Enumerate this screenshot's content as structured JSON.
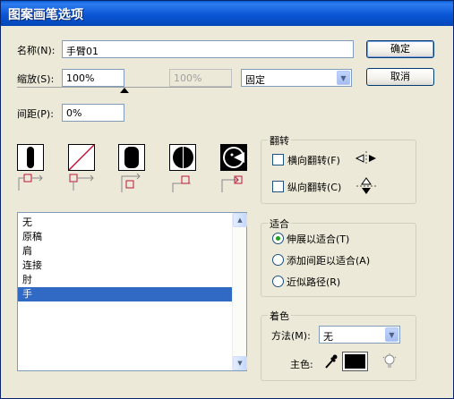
{
  "window": {
    "title": "图案画笔选项"
  },
  "name": {
    "label": "名称(N):",
    "value": "手臂01"
  },
  "scale": {
    "label": "缩放(S):",
    "value": "100%",
    "max_value": "100%",
    "mode": "固定"
  },
  "spacing": {
    "label": "间距(P):",
    "value": "0%"
  },
  "buttons": {
    "ok": "确定",
    "cancel": "取消"
  },
  "flip": {
    "title": "翻转",
    "horizontal": {
      "label": "横向翻转(F)",
      "checked": false
    },
    "vertical": {
      "label": "纵向翻转(C)",
      "checked": false
    }
  },
  "fit": {
    "title": "适合",
    "options": [
      {
        "label": "伸展以适合(T)",
        "selected": true
      },
      {
        "label": "添加间距以适合(A)",
        "selected": false
      },
      {
        "label": "近似路径(R)",
        "selected": false
      }
    ]
  },
  "color": {
    "title": "着色",
    "method_label": "方法(M):",
    "method_value": "无",
    "key_label": "主色:",
    "key_color": "#000000"
  },
  "tiles": [
    "side-tile",
    "outer-corner-tile",
    "inner-corner-tile",
    "start-tile",
    "end-tile"
  ],
  "pattern_list": [
    "无",
    "原稿",
    "肩",
    "连接",
    "肘",
    "手"
  ],
  "selected_pattern": "手",
  "colors": {
    "titlebar": "#0a56d6",
    "selection": "#316ac5",
    "dialog": "#ece9d8",
    "none_slash": "#c0143c"
  }
}
